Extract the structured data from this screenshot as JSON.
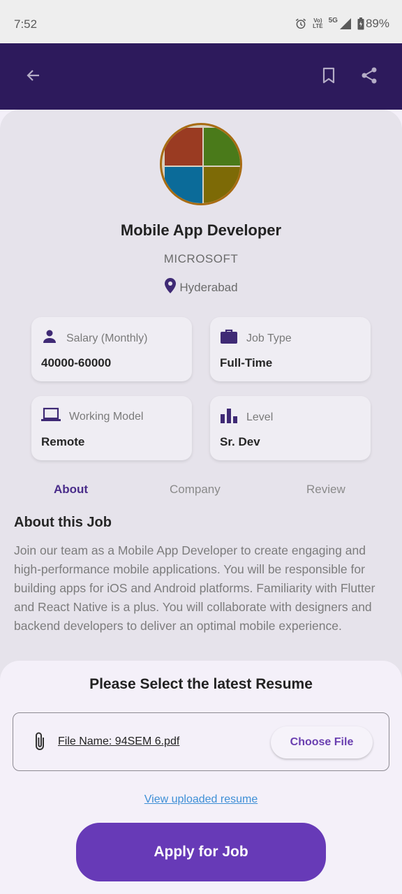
{
  "status_bar": {
    "time": "7:52",
    "battery": "89%",
    "network": "5G",
    "carrier_badge_top": "Vo)",
    "carrier_badge_bottom": "LTE"
  },
  "app_bar": {
    "back_icon": "arrow-left-icon",
    "bookmark_icon": "bookmark-icon",
    "share_icon": "share-icon",
    "background": "#2d1a5c"
  },
  "job": {
    "title": "Mobile App Developer",
    "company": "MICROSOFT",
    "location": "Hyderabad",
    "logo_icon": "microsoft-logo",
    "logo_colors": [
      "#9a3b22",
      "#4a7a1a",
      "#0b6b99",
      "#7d6a06"
    ]
  },
  "info_cards": [
    {
      "label": "Salary (Monthly)",
      "value": "40000-60000",
      "icon": "person-icon"
    },
    {
      "label": "Job Type",
      "value": "Full-Time",
      "icon": "briefcase-icon"
    },
    {
      "label": "Working Model",
      "value": "Remote",
      "icon": "laptop-icon"
    },
    {
      "label": "Level",
      "value": "Sr. Dev",
      "icon": "bar-chart-icon"
    }
  ],
  "tabs": [
    {
      "label": "About",
      "active": true
    },
    {
      "label": "Company",
      "active": false
    },
    {
      "label": "Review",
      "active": false
    }
  ],
  "about": {
    "heading": "About this Job",
    "text": "Join our team as a Mobile App Developer to create engaging and high-performance mobile applications. You will be responsible for building apps for iOS and Android platforms. Familiarity with Flutter and React Native is a plus. You will collaborate with designers and backend developers to deliver an optimal mobile experience."
  },
  "sheet": {
    "title": "Please Select the latest Resume",
    "file_name": "File Name: 94SEM 6.pdf",
    "choose_label": "Choose File",
    "view_link": "View uploaded resume",
    "apply_label": "Apply for Job",
    "accent": "#673ab7"
  }
}
